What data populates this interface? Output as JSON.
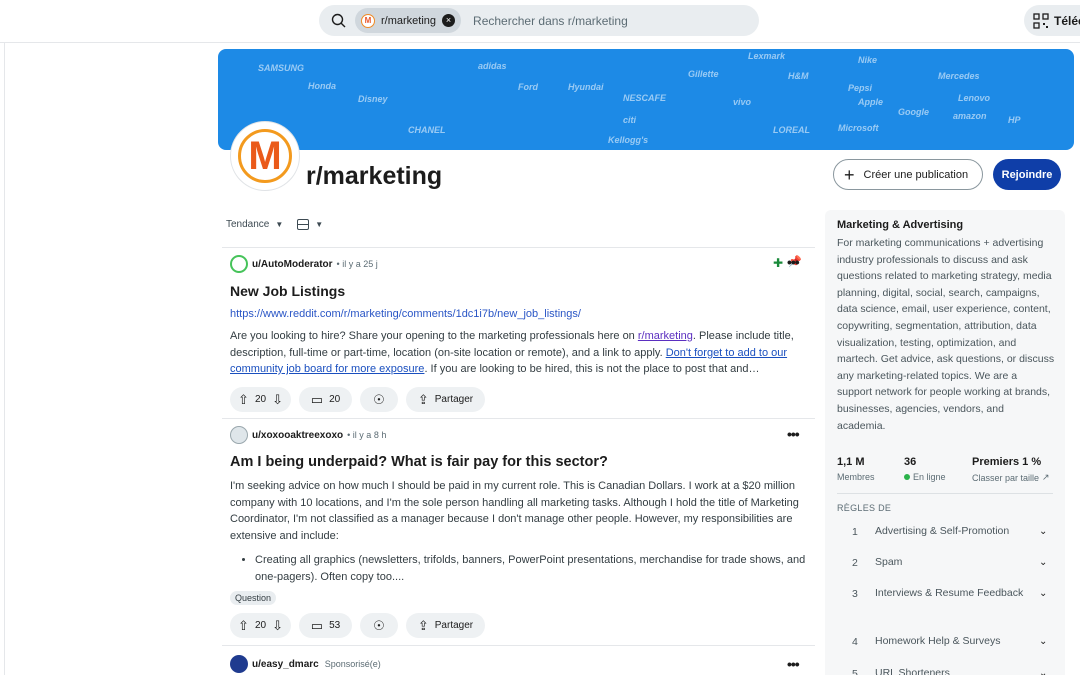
{
  "header": {
    "search_chip": "r/marketing",
    "search_placeholder": "Rechercher dans r/marketing",
    "download_label": "Téléc"
  },
  "banner": {
    "brands": [
      "Lexmark",
      "SAMSUNG",
      "adidas",
      "Gillette",
      "H&M",
      "Pepsi",
      "Disney",
      "NESCAFE",
      "CHANEL",
      "citi",
      "Google",
      "amazon",
      "HP",
      "Apple",
      "LOREAL",
      "Microsoft",
      "Nike",
      "Ford",
      "Hyundai",
      "vivo",
      "Lenovo",
      "Kellogg's",
      "Honda",
      "Mercedes"
    ]
  },
  "subreddit": {
    "avatar_letter": "M",
    "name": "r/marketing",
    "create_label": "Créer une publication",
    "join_label": "Rejoindre"
  },
  "sort": {
    "label": "Tendance"
  },
  "posts": [
    {
      "user": "u/AutoModerator",
      "time": "• il y a 25 j",
      "title": "New Job Listings",
      "link": "https://www.reddit.com/r/marketing/comments/1dc1i7b/new_job_listings/",
      "body_1": "Are you looking to hire? Share your opening to the marketing professionals here on ",
      "body_link1": "r/marketing",
      "body_2": ". Please include title, description, full-time or part-time, location (on-site location or remote), and a link to apply. ",
      "body_link2": "Don't forget to add to our community job board for more exposure",
      "body_3": ". If you are looking to be hired, this is not the place to post that and…",
      "votes": "20",
      "comments": "20",
      "share": "Partager"
    },
    {
      "user": "u/xoxooaktreexoxo",
      "time": "• il y a 8 h",
      "title": "Am I being underpaid? What is fair pay for this sector?",
      "body": "I'm seeking advice on how much I should be paid in my current role. This is Canadian Dollars. I work at a $20 million company with 10 locations, and I'm the sole person handling all marketing tasks. Although I hold the title of Marketing Coordinator, I'm not classified as a manager because I don't manage other people. However, my responsibilities are extensive and include:",
      "bullet": "Creating all graphics (newsletters, trifolds, banners, PowerPoint presentations, merchandise for trade shows, and one-pagers). Often copy too....",
      "flair": "Question",
      "votes": "20",
      "comments": "53",
      "share": "Partager"
    },
    {
      "user": "u/easy_dmarc",
      "time": "Sponsorisé(e)"
    }
  ],
  "sidebar": {
    "title": "Marketing & Advertising",
    "description": "For marketing communications + advertising industry professionals to discuss and ask questions related to marketing strategy, media planning, digital, social, search, campaigns, data science, email, user experience, content, copywriting, segmentation, attribution, data visualization, testing, optimization, and martech. Get advice, ask questions, or discuss any marketing-related topics. We are a support network for people working at brands, businesses, agencies, vendors, and academia.",
    "members": "1,1 M",
    "members_label": "Membres",
    "online": "36",
    "online_label": "En ligne",
    "rank": "Premiers 1 %",
    "rank_label": "Classer par taille",
    "rules_heading": "RÈGLES DE",
    "rules": [
      {
        "num": "1",
        "text": "Advertising & Self-Promotion"
      },
      {
        "num": "2",
        "text": "Spam"
      },
      {
        "num": "3",
        "text": "Interviews & Resume Feedback"
      },
      {
        "num": "4",
        "text": "Homework Help & Surveys"
      },
      {
        "num": "5",
        "text": "URL Shorteners"
      }
    ]
  }
}
